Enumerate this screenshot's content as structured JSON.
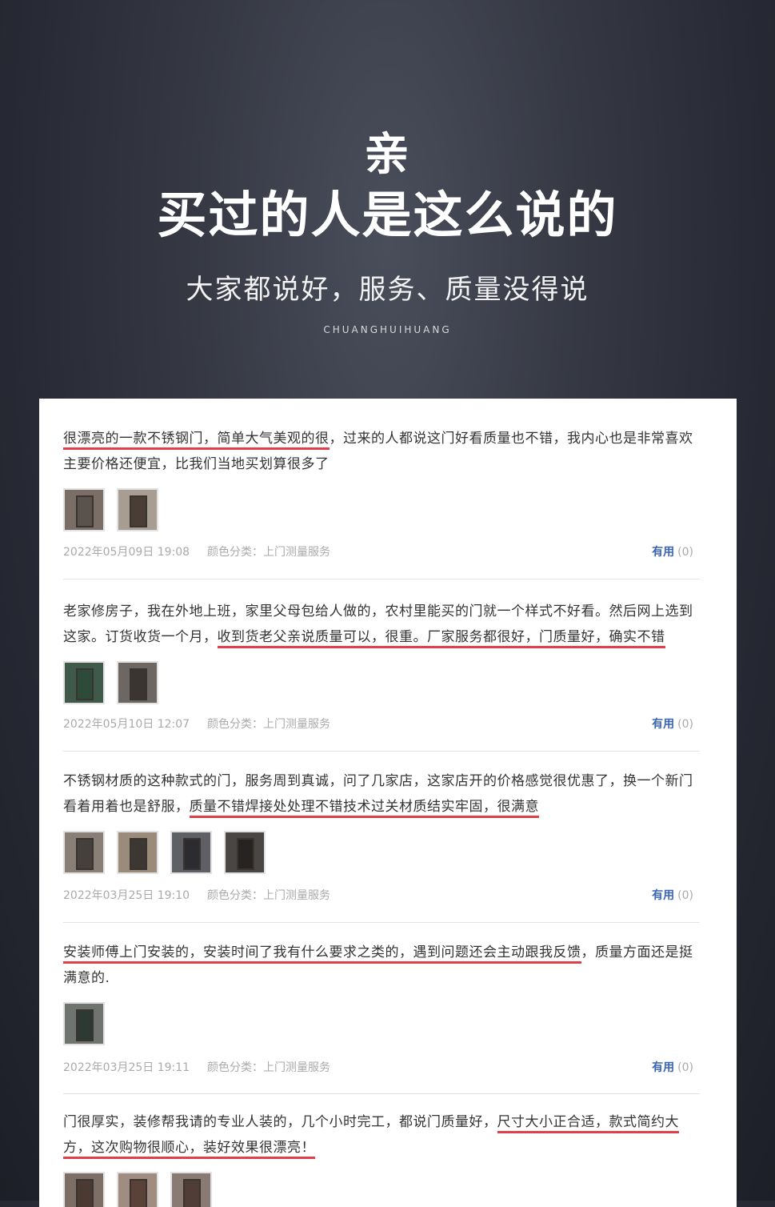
{
  "hero": {
    "line1": "亲",
    "line2": "买过的人是这么说的",
    "subtitle": "大家都说好，服务、质量没得说",
    "brand": "CHUANGHUIHUANG"
  },
  "colors": {
    "background": "#2a2c36",
    "highlight_underline": "#e0404a",
    "useful_link": "#3a64b4",
    "meta_text": "#aaaaaa"
  },
  "reviews": [
    {
      "text_parts": [
        "很漂亮的一款不锈钢门，简单大气美观的很",
        "，过来的人都说这门好看质量也不错，我内心也是非常喜欢主要价格还便宜，比我们当地买划算很多了"
      ],
      "date": "2022年05月09日 19:08",
      "category": "颜色分类：上门测量服务",
      "useful_label": "有用",
      "useful_count": "(0)"
    },
    {
      "text_parts": [
        "老家修房子，我在外地上班，家里父母包给人做的，农村里能买的门就一个样式不好看。然后网上选到这家。订货收货一个月，",
        "收到货老父亲说质量可以，很重。厂家服务都很好，门质量好，确实不错"
      ],
      "date": "2022年05月10日 12:07",
      "category": "颜色分类：上门测量服务",
      "useful_label": "有用",
      "useful_count": "(0)"
    },
    {
      "text_parts": [
        "不锈钢材质的这种款式的门，服务周到真诚，问了几家店，这家店开的价格感觉很优惠了，换一个新门看着用着也是舒服，",
        "质量不错焊接处处理不错技术过关材质结实牢固，很满意"
      ],
      "date": "2022年03月25日 19:10",
      "category": "颜色分类：上门测量服务",
      "useful_label": "有用",
      "useful_count": "(0)"
    },
    {
      "text_parts": [
        "安装师傅上门安装的，安装时间了我有什么要求之类的，遇到问题还会主动跟我反馈",
        "，质量方面还是挺满意的."
      ],
      "date": "2022年03月25日 19:11",
      "category": "颜色分类：上门测量服务",
      "useful_label": "有用",
      "useful_count": "(0)"
    },
    {
      "text_parts": [
        "门很厚实，装修帮我请的专业人装的，几个小时完工，都说门质量好，",
        "尺寸大小正合适，款式简约大方，这次购物很顺心，装好效果很漂亮！"
      ]
    }
  ]
}
